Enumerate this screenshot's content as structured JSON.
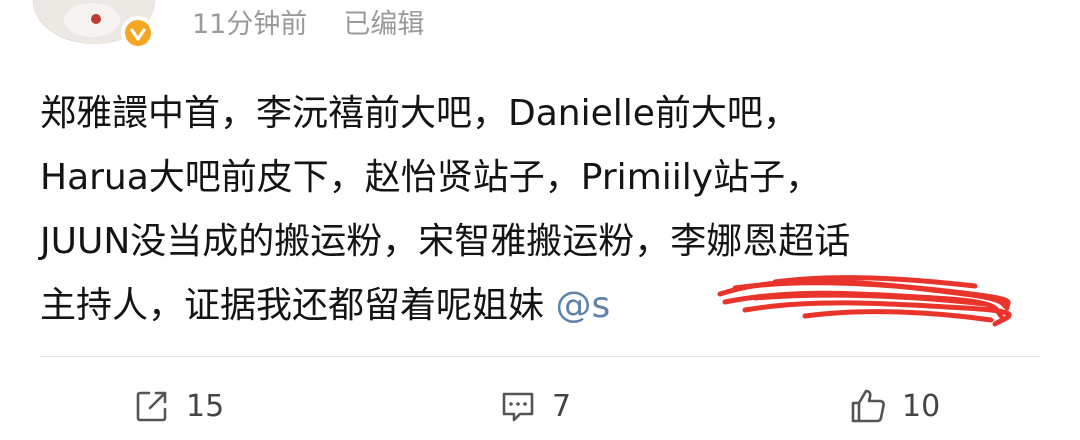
{
  "post": {
    "time": "11分钟前",
    "edited": "已编辑",
    "lines": [
      "郑雅譞中首，李沅禧前大吧，Danielle前大吧，",
      "Harua大吧前皮下，赵怡贤站子，Primiily站子，",
      "JUUN没当成的搬运粉，宋智雅搬运粉，李娜恩超话",
      "主持人，证据我还都留着呢姐妹 "
    ],
    "mention": "@s"
  },
  "actions": {
    "repost_count": "15",
    "comment_count": "7",
    "like_count": "10"
  },
  "icons": {
    "badge": "verified-badge-icon",
    "repost": "share-icon",
    "comment": "comment-icon",
    "like": "thumbs-up-icon"
  },
  "colors": {
    "mention": "#5f82aa",
    "badge": "#f5a623",
    "scribble": "#e8231a",
    "meta": "#9a9a9a"
  }
}
